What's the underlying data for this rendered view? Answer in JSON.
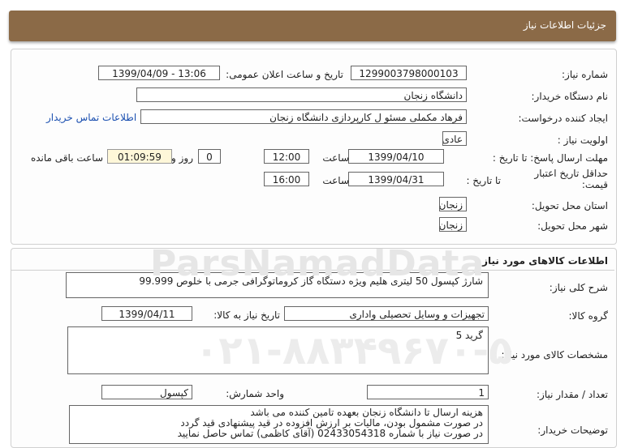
{
  "header": {
    "title": "جزئیات اطلاعات نیاز"
  },
  "watermark": {
    "brand": "ParsNamadData",
    "phone": "۰۲۱-۸۸۳۴۹۶۷۰-۵"
  },
  "info": {
    "need_number_label": "شماره نیاز:",
    "need_number": "1299003798000103",
    "announce_label": "تاریخ و ساعت اعلان عمومی:",
    "announce_value": "1399/04/09 - 13:06",
    "buyer_org_label": "نام دستگاه خریدار:",
    "buyer_org": "دانشگاه زنجان",
    "creator_label": "ایجاد کننده درخواست:",
    "creator": "فرهاد مکملی مسئو ل کارپردازی دانشگاه زنجان",
    "contact_link": "اطلاعات تماس خریدار",
    "priority_label": "اولویت نیاز :",
    "priority": "عادی",
    "deadline_label": "مهلت ارسال پاسخ: تا تاریخ :",
    "deadline_date": "1399/04/10",
    "time_label": "ساعت",
    "deadline_time": "12:00",
    "days_value": "0",
    "days_label": "روز و",
    "remaining_time": "01:09:59",
    "remaining_label": "ساعت باقی مانده",
    "validity_label_1": "حداقل تاریخ اعتبار",
    "validity_label_2": "قیمت:",
    "validity_to_label": "تا تاریخ :",
    "validity_date": "1399/04/31",
    "validity_time": "16:00",
    "province_label": "استان محل تحویل:",
    "province": "زنجان",
    "city_label": "شهر محل تحویل:",
    "city": "زنجان"
  },
  "goods": {
    "section_title": "اطلاعات کالاهای مورد نیاز",
    "summary_label": "شرح کلی نیاز:",
    "summary": "شارژ کپسول 50 لیتری هلیم ویژه دستگاه گاز کروماتوگرافی جرمی با خلوص 99.999",
    "group_label": "گروه کالا:",
    "group": "تجهیزات و وسایل تحصیلی واداری",
    "need_date_label": "تاریخ نیاز به کالا:",
    "need_date": "1399/04/11",
    "specs_label": "مشخصات کالای مورد نیاز:",
    "specs": "گرید 5",
    "qty_label": "تعداد / مقدار نیاز:",
    "qty": "1",
    "unit_label": "واحد شمارش:",
    "unit": "کپسول",
    "buyer_notes_label": "توضیحات خریدار:",
    "buyer_notes": [
      "هزینه ارسال تا دانشگاه زنجان بعهده تامین کننده می باشد",
      "در صورت مشمول بودن، مالیات بر ارزش افزوده در قید پیشنهادی قید گردد",
      "در صورت نیاز با شماره 02433054318 (آقای کاظمی) تماس حاصل نمایید"
    ]
  }
}
